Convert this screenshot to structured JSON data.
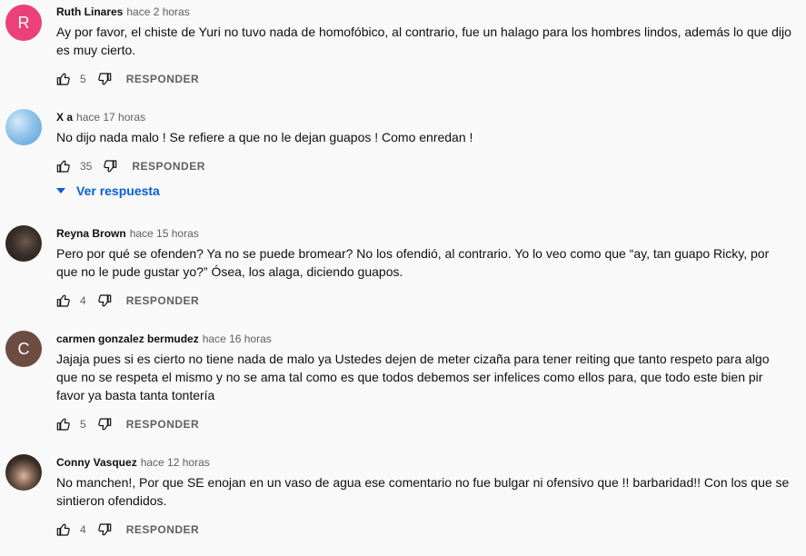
{
  "comments": [
    {
      "author": "Ruth Linares",
      "time": "hace 2 horas",
      "avatar_letter": "R",
      "avatar_color": "#ec407a",
      "text": "Ay por favor, el chiste de Yuri no tuvo nada de homofóbico, al contrario, fue un halago para los hombres lindos, además lo que dijo es muy cierto.",
      "likes": "5",
      "reply_label": "RESPONDER"
    },
    {
      "author": "X a",
      "time": "hace 17 horas",
      "avatar_letter": "",
      "avatar_color": "#8fc3ea",
      "text": "No dijo nada malo ! Se refiere a que no le dejan guapos ! Como enredan !",
      "likes": "35",
      "reply_label": "RESPONDER",
      "view_replies": "Ver respuesta"
    },
    {
      "author": "Reyna Brown",
      "time": "hace 15 horas",
      "avatar_letter": "",
      "avatar_color": "#2b2522",
      "text": "Pero por qué se ofenden? Ya no se puede bromear? No los ofendió, al contrario. Yo lo veo como que “ay, tan guapo Ricky, por que no le pude gustar yo?” Ósea, los alaga, diciendo guapos.",
      "likes": "4",
      "reply_label": "RESPONDER"
    },
    {
      "author": "carmen gonzalez bermudez",
      "time": "hace 16 horas",
      "avatar_letter": "C",
      "avatar_color": "#6d4c41",
      "text": "Jajaja pues si es cierto no tiene nada de malo ya Ustedes dejen de meter cizaña para tener reiting que tanto respeto para algo que no se respeta el mismo y no se ama tal como es que todos debemos ser infelices como ellos para, que todo este bien pir favor ya basta tanta tontería",
      "likes": "5",
      "reply_label": "RESPONDER"
    },
    {
      "author": "Conny Vasquez",
      "time": "hace 12 horas",
      "avatar_letter": "",
      "avatar_color": "#3a302a",
      "text": "No manchen!, Por que SE enojan en un vaso de agua  ese comentario no fue bulgar ni ofensivo que !! barbaridad!! Con los que se sintieron ofendidos.",
      "likes": "4",
      "reply_label": "RESPONDER"
    }
  ]
}
